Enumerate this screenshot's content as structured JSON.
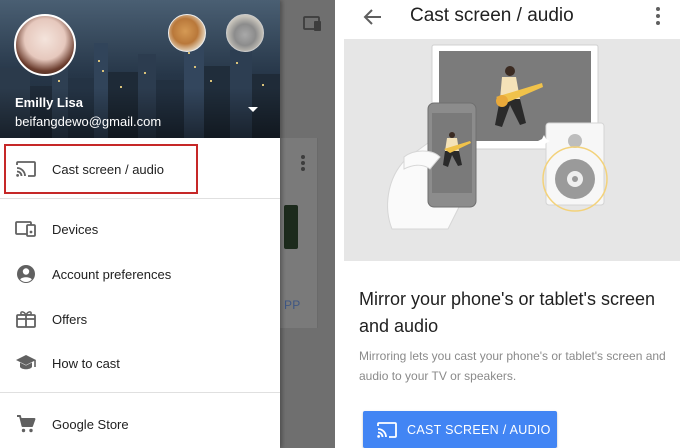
{
  "drawer": {
    "user": {
      "name": "Emilly Lisa",
      "email": "beifangdewo@gmail.com"
    },
    "items": [
      {
        "label": "Cast screen / audio",
        "icon": "cast-icon"
      },
      {
        "label": "Devices",
        "icon": "devices-icon"
      },
      {
        "label": "Account preferences",
        "icon": "account-circle-icon"
      },
      {
        "label": "Offers",
        "icon": "gift-icon"
      },
      {
        "label": "How to cast",
        "icon": "school-icon"
      },
      {
        "label": "Google Store",
        "icon": "cart-icon"
      }
    ],
    "highlight_color": "#c62828"
  },
  "background_app": {
    "link_text": "PP"
  },
  "cast_page": {
    "title": "Cast screen / audio",
    "heading": "Mirror your phone's or tablet's screen and audio",
    "description": "Mirroring lets you cast your phone's or tablet's screen and audio to your TV or speakers.",
    "button_label": "CAST SCREEN / AUDIO",
    "accent_color": "#4285f4"
  }
}
